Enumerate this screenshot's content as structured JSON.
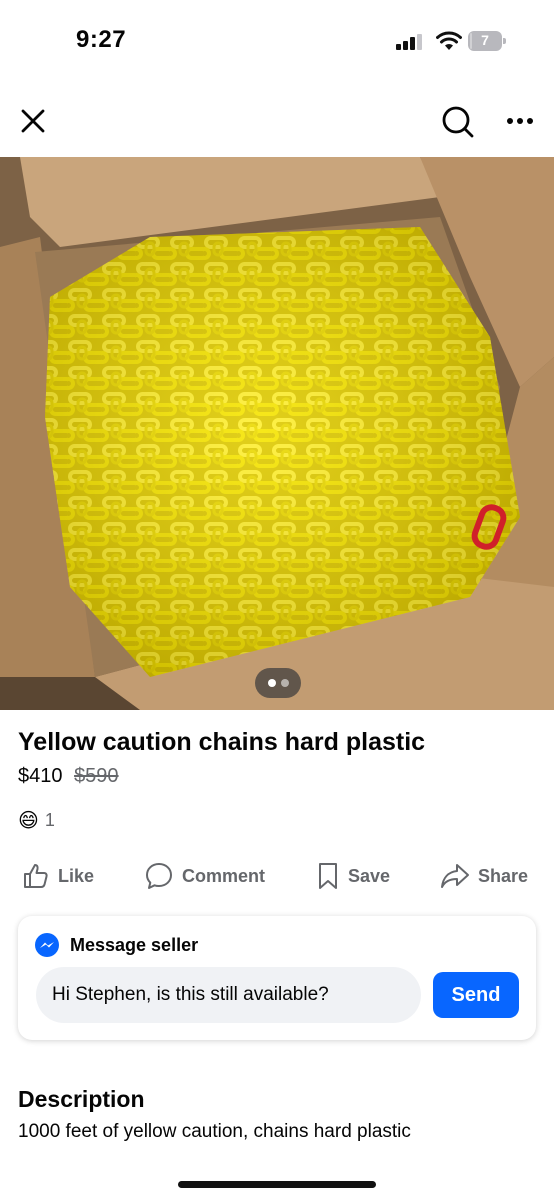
{
  "status_bar": {
    "time": "9:27",
    "battery_level": "7",
    "battery_fraction": 0.07
  },
  "nav": {
    "close_icon": "close-icon",
    "search_icon": "search-icon",
    "more_icon": "more-horizontal-icon"
  },
  "listing": {
    "photo_pages": 2,
    "photo_current_page": 1,
    "title": "Yellow caution chains hard plastic",
    "price": "$410",
    "original_price": "$590",
    "reaction_emoji": "😄",
    "reaction_count": "1"
  },
  "actions": {
    "like": "Like",
    "comment": "Comment",
    "save": "Save",
    "share": "Share"
  },
  "message": {
    "heading": "Message seller",
    "input_value": "Hi Stephen, is this still available?",
    "send_label": "Send"
  },
  "description": {
    "heading": "Description",
    "text": "1000 feet of yellow caution, chains hard plastic"
  },
  "colors": {
    "accent": "#0866ff",
    "secondary_text": "#65676b",
    "chain_yellow": "#f2e000",
    "box_cardboard": "#b8926a"
  }
}
